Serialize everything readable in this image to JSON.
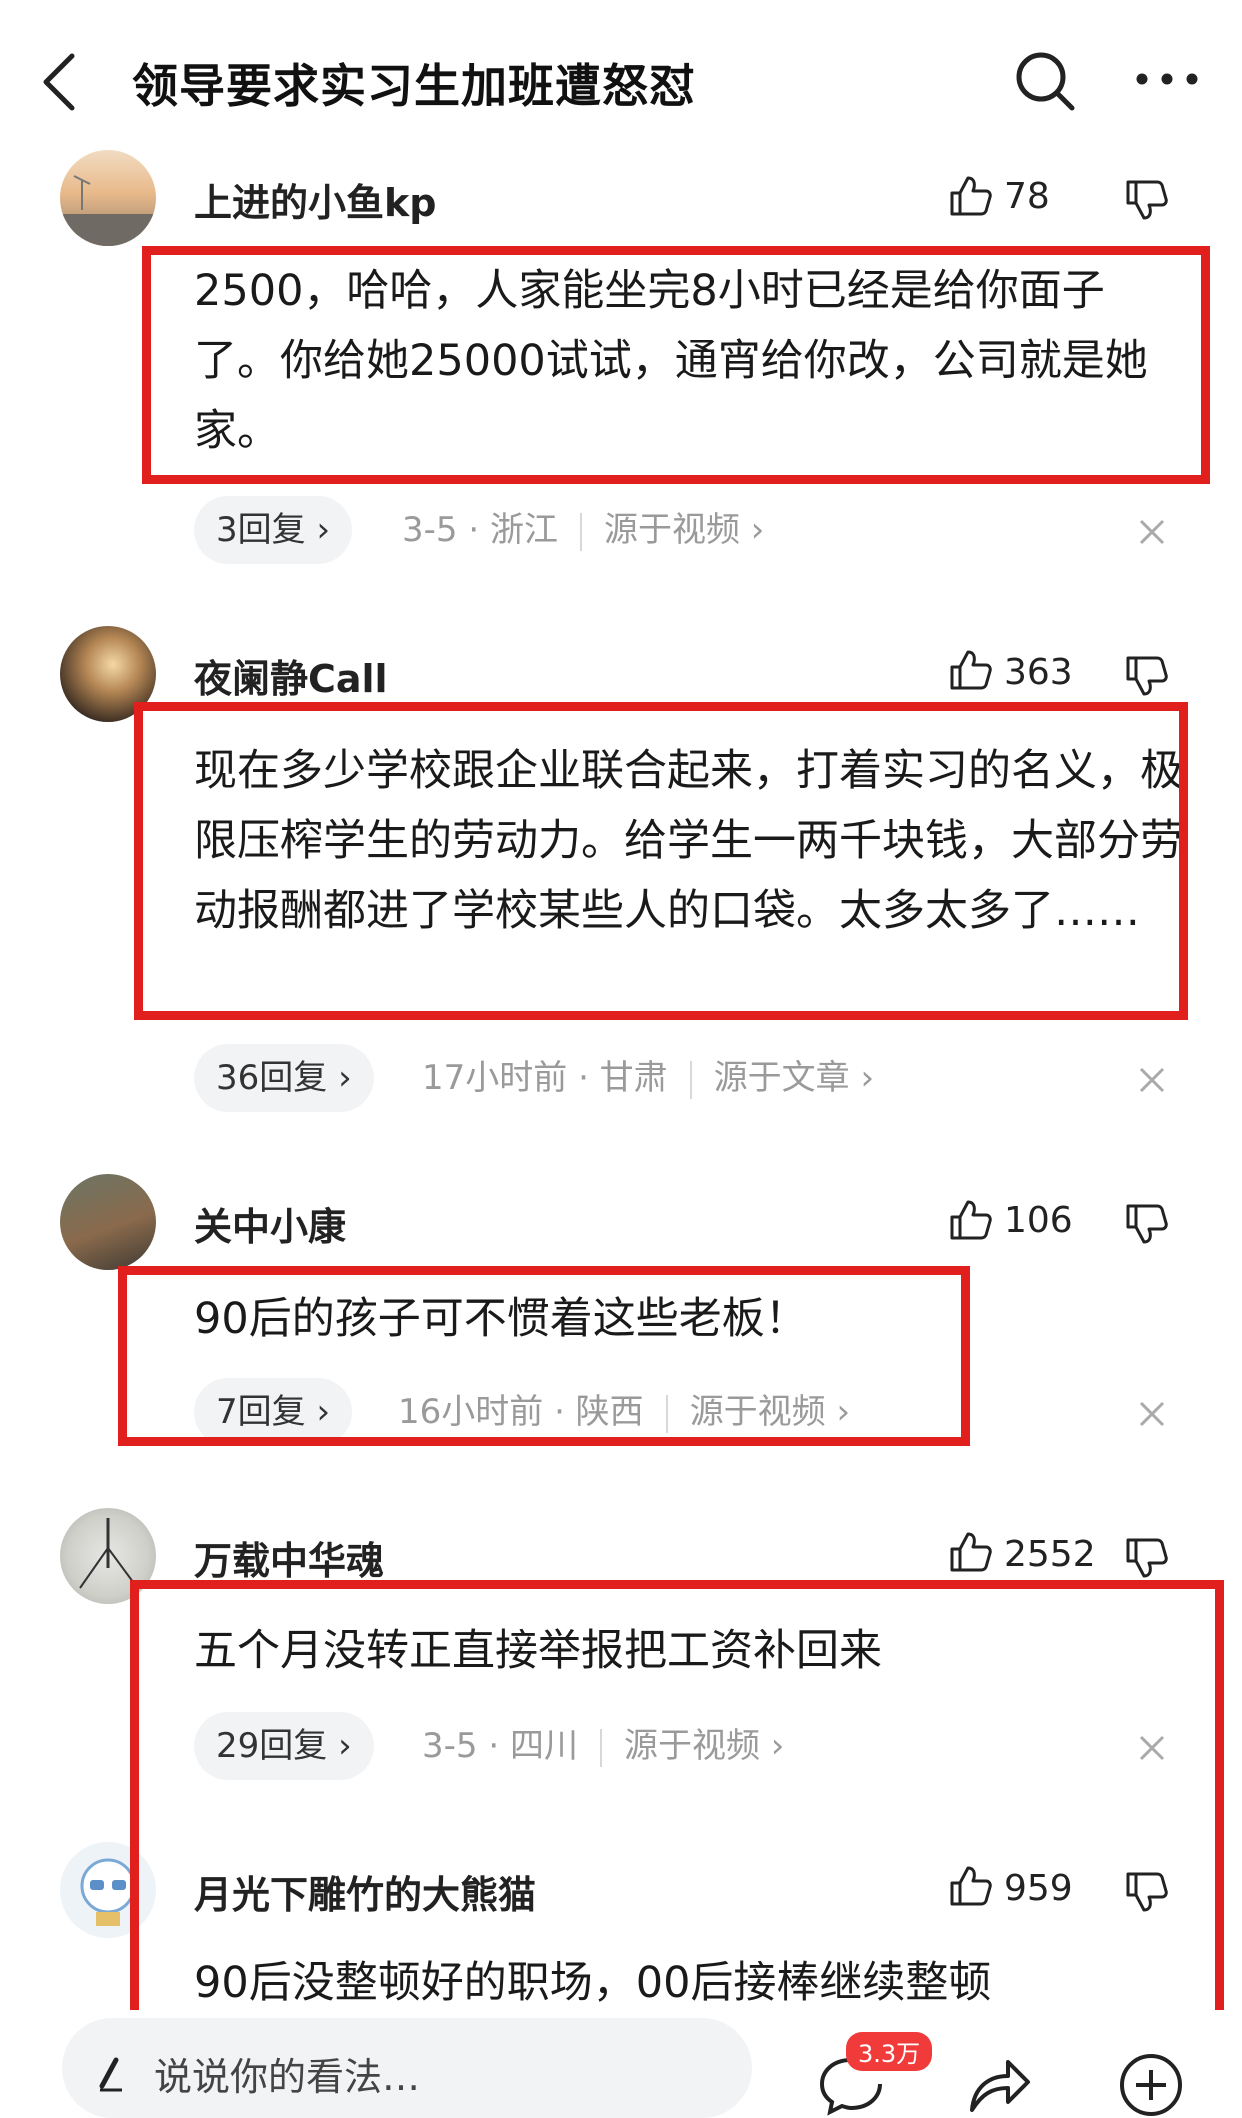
{
  "header": {
    "title": "领导要求实习生加班遭怒怼"
  },
  "comments": [
    {
      "username": "上进的小鱼kp",
      "likes": "78",
      "text": "2500，哈哈，人家能坐完8小时已经是给你面子了。你给她25000试试，通宵给你改，公司就是她家。",
      "replies": "3回复",
      "time_location": "3-5 · 浙江",
      "source": "源于视频"
    },
    {
      "username": "夜阑静Call",
      "likes": "363",
      "text": "现在多少学校跟企业联合起来，打着实习的名义，极限压榨学生的劳动力。给学生一两千块钱，大部分劳动报酬都进了学校某些人的口袋。太多太多了……",
      "replies": "36回复",
      "time_location": "17小时前 · 甘肃",
      "source": "源于文章"
    },
    {
      "username": "关中小康",
      "likes": "106",
      "text": "90后的孩子可不惯着这些老板！",
      "replies": "7回复",
      "time_location": "16小时前 · 陕西",
      "source": "源于视频"
    },
    {
      "username": "万载中华魂",
      "likes": "2552",
      "text": "五个月没转正直接举报把工资补回来",
      "replies": "29回复",
      "time_location": "3-5 · 四川",
      "source": "源于视频"
    },
    {
      "username": "月光下雕竹的大熊猫",
      "likes": "959",
      "text": "90后没整顿好的职场，00后接棒继续整顿"
    }
  ],
  "bottom": {
    "placeholder": "说说你的看法…",
    "comment_badge": "3.3万"
  },
  "colors": {
    "highlight_red": "#e1201d",
    "badge_red": "#f13b3b",
    "meta_gray": "#9a9a9a"
  }
}
